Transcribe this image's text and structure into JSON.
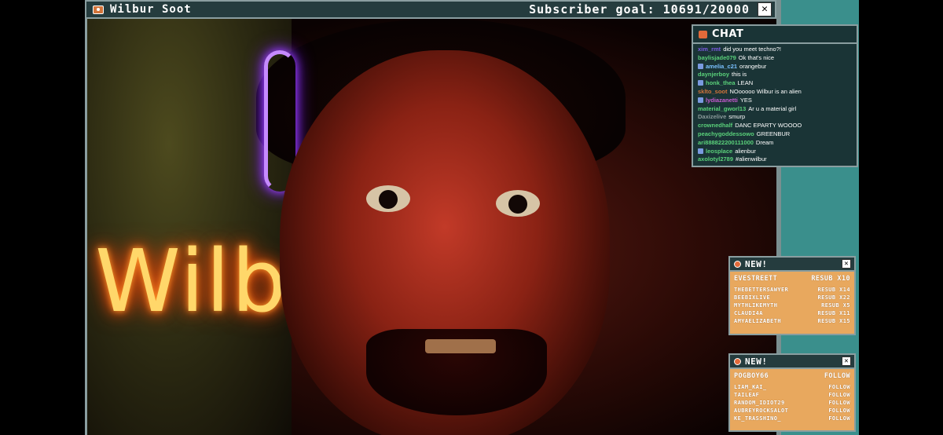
{
  "stream": {
    "streamer_name": "Wilbur Soot",
    "subscriber_goal": "Subscriber goal: 10691/20000",
    "close_glyph": "✕",
    "neon_sign_text": "Wilb"
  },
  "chat": {
    "title": "CHAT",
    "messages": [
      {
        "user": "xim_rmt",
        "text": "did you meet techno?!",
        "color": "#7a5ae0",
        "badge": false
      },
      {
        "user": "baylisjade079",
        "text": "Ok that's nice",
        "color": "#5ad07a",
        "badge": false
      },
      {
        "user": "amelia_c21",
        "text": "orangebur",
        "color": "#7ac0ff",
        "badge": true
      },
      {
        "user": "daynjerboy",
        "text": "this is",
        "color": "#5ad07a",
        "badge": false
      },
      {
        "user": "honk_thea",
        "text": "LEAN",
        "color": "#5ad07a",
        "badge": true
      },
      {
        "user": "sklto_soot",
        "text": "NOooooo Wilbur is an alien",
        "color": "#d2743a",
        "badge": false
      },
      {
        "user": "lydiazanetti",
        "text": "YES",
        "color": "#c85ad0",
        "badge": true
      },
      {
        "user": "material_gworl13",
        "text": "Ar u a material girl",
        "color": "#5ad07a",
        "badge": false
      },
      {
        "user": "Daxizelive",
        "text": "smurp",
        "color": "#8a9a9a",
        "badge": false
      },
      {
        "user": "crownedhalf",
        "text": "DANC EPARTY WOOOO",
        "color": "#5ad07a",
        "badge": false
      },
      {
        "user": "peachygoddessowo",
        "text": "GREENBUR",
        "color": "#5ad07a",
        "badge": false
      },
      {
        "user": "ari888822200111000",
        "text": "Dream",
        "color": "#5ad07a",
        "badge": false
      },
      {
        "user": "leosplace",
        "text": "alienbur",
        "color": "#5ad07a",
        "badge": true
      },
      {
        "user": "axolotyl2789",
        "text": "#alienwilbur",
        "color": "#5ad07a",
        "badge": false
      }
    ]
  },
  "resubs": {
    "title": "NEW!",
    "rows": [
      {
        "who": "EVESTREETT",
        "what": "RESUB X10"
      },
      {
        "who": "THEBETTERSAWYER",
        "what": "RESUB X14"
      },
      {
        "who": "BEEBIXLIVE",
        "what": "RESUB X22"
      },
      {
        "who": "MYTHLIKEMYTH",
        "what": "RESUB X5"
      },
      {
        "who": "CLAUDI4A",
        "what": "RESUB X11"
      },
      {
        "who": "AMYAELIZABETH",
        "what": "RESUB X15"
      }
    ]
  },
  "follows": {
    "title": "NEW!",
    "rows": [
      {
        "who": "POGBOY66",
        "what": "FOLLOW"
      },
      {
        "who": "LIAM_KAI_",
        "what": "FOLLOW"
      },
      {
        "who": "TAILEAF",
        "what": "FOLLOW"
      },
      {
        "who": "RANDOM_IDIOT29",
        "what": "FOLLOW"
      },
      {
        "who": "AUBREYROCKSALOT",
        "what": "FOLLOW"
      },
      {
        "who": "KE_TRASSHINO_",
        "what": "FOLLOW"
      }
    ]
  }
}
